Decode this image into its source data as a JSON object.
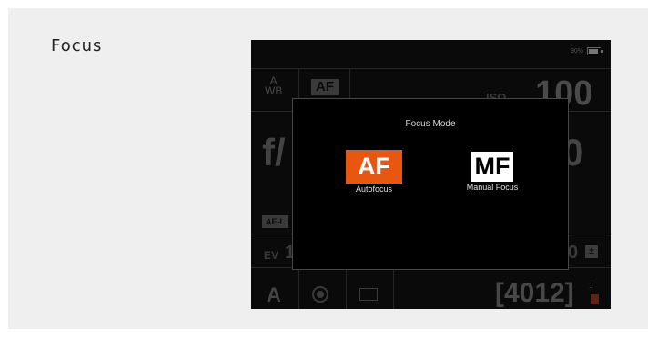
{
  "section": {
    "title": "Focus"
  },
  "camera": {
    "battery": "90%",
    "wb_line1": "A",
    "wb_line2": "WB",
    "af_indicator": "AF",
    "iso_label": "ISO",
    "iso_value": "100",
    "aperture_partial": "f/",
    "shutter_partial": "0",
    "ae_tag": "AE-L",
    "ev_label": "EV",
    "ev_value": "1",
    "ev_right": "0",
    "mode": "A",
    "shots_remaining": "[4012]",
    "card_number": "1"
  },
  "dialog": {
    "title": "Focus Mode",
    "options": [
      {
        "badge": "AF",
        "label": "Autofocus",
        "selected": true
      },
      {
        "badge": "MF",
        "label": "Manual Focus",
        "selected": false
      }
    ]
  },
  "colors": {
    "accent": "#e8560f",
    "panel_bg": "#efefef",
    "screen_bg": "#0a0a0a"
  },
  "icons": [
    "battery-icon",
    "record-icon",
    "frame-icon",
    "exposure-comp-icon",
    "memory-card-icon"
  ]
}
